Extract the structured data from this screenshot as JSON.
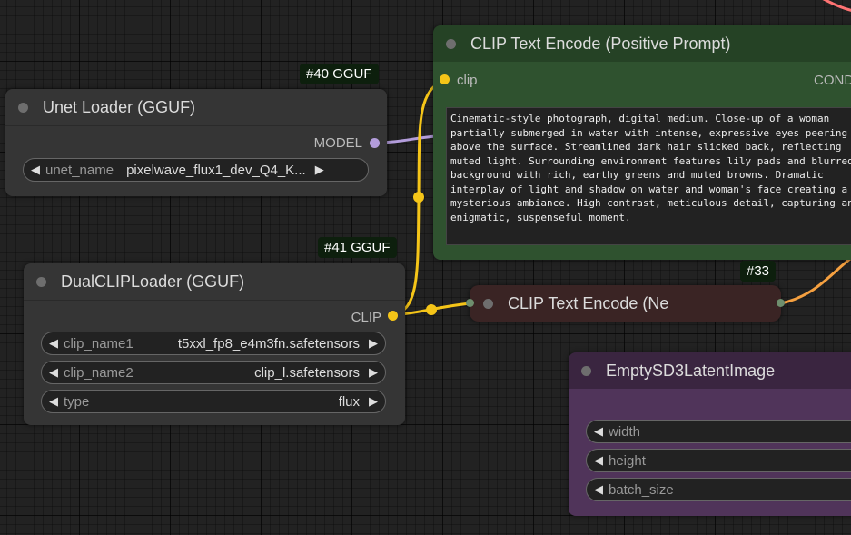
{
  "colors": {
    "canvas_bg": "#222222",
    "node_default": "#353535",
    "node_positive": "#2b4d2b",
    "node_negative": "#3a2424",
    "node_latent": "#4a2f4f",
    "wire_clip": "#f5c518",
    "wire_model": "#b39ddb",
    "wire_conditioning": "#f5a040",
    "wire_latent": "#ff8080"
  },
  "badges": {
    "unet": "#40 GGUF",
    "dualclip": "#41 GGUF",
    "negative": "#33"
  },
  "nodes": {
    "unet_loader": {
      "title": "Unet Loader (GGUF)",
      "output_label": "MODEL",
      "widget": {
        "label": "unet_name",
        "value": "pixelwave_flux1_dev_Q4_K..."
      }
    },
    "dual_clip_loader": {
      "title": "DualCLIPLoader (GGUF)",
      "output_label": "CLIP",
      "widgets": [
        {
          "label": "clip_name1",
          "value": "t5xxl_fp8_e4m3fn.safetensors"
        },
        {
          "label": "clip_name2",
          "value": "clip_l.safetensors"
        },
        {
          "label": "type",
          "value": "flux"
        }
      ]
    },
    "clip_positive": {
      "title": "CLIP Text Encode (Positive Prompt)",
      "input_label": "clip",
      "output_label": "COND",
      "prompt_text": "Cinematic-style photograph, digital medium. Close-up of a woman partially submerged in water with intense, expressive eyes peering above the surface. Streamlined dark hair slicked back, reflecting muted light. Surrounding environment features lily pads and blurred background with rich, earthy greens and muted browns. Dramatic interplay of light and shadow on water and woman's face creating a mysterious ambiance. High contrast, meticulous detail, capturing an enigmatic, suspenseful moment."
    },
    "clip_negative": {
      "title": "CLIP Text Encode (Ne"
    },
    "empty_latent": {
      "title": "EmptySD3LatentImage",
      "widgets": [
        {
          "label": "width"
        },
        {
          "label": "height"
        },
        {
          "label": "batch_size"
        }
      ]
    }
  }
}
